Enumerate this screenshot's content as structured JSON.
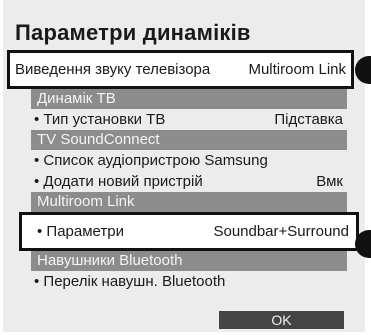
{
  "title": "Параметри динаміків",
  "highlighted_row": {
    "label": "Виведення звуку телевізора",
    "value": "Multiroom Link"
  },
  "sections": {
    "tv_speaker": {
      "header": "Динамік ТВ",
      "install_type": {
        "label": "Тип установки ТВ",
        "value": "Підставка"
      }
    },
    "soundconnect": {
      "header": "TV SoundConnect",
      "device_list": {
        "label": "Список аудіопристрою Samsung"
      },
      "add_device": {
        "label": "Додати новий пристрій",
        "value": "Вмк"
      }
    },
    "multiroom": {
      "header": "Multiroom Link",
      "settings": {
        "label": "Параметри",
        "value": "Soundbar+Surround"
      }
    },
    "bluetooth": {
      "header": "Навушники Bluetooth",
      "list": {
        "label": "Перелік навушн. Bluetooth"
      }
    }
  },
  "ok_label": "OK"
}
